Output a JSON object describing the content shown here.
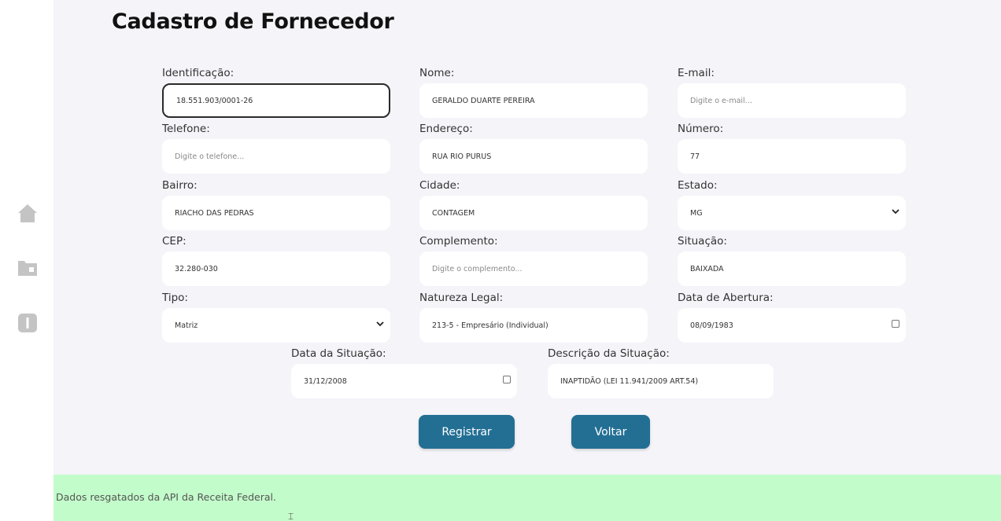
{
  "page": {
    "title": "Cadastro de Fornecedor"
  },
  "sidebar": {
    "icons": [
      "home-icon",
      "folder-icon",
      "info-icon"
    ]
  },
  "fields": {
    "identificacao": {
      "label": "Identificação:",
      "value": "18.551.903/0001-26"
    },
    "nome": {
      "label": "Nome:",
      "value": "GERALDO DUARTE PEREIRA"
    },
    "email": {
      "label": "E-mail:",
      "placeholder": "Digite o e-mail..."
    },
    "telefone": {
      "label": "Telefone:",
      "placeholder": "Digite o telefone..."
    },
    "endereco": {
      "label": "Endereço:",
      "value": "RUA RIO PURUS"
    },
    "numero": {
      "label": "Número:",
      "value": "77"
    },
    "bairro": {
      "label": "Bairro:",
      "value": "RIACHO DAS PEDRAS"
    },
    "cidade": {
      "label": "Cidade:",
      "value": "CONTAGEM"
    },
    "estado": {
      "label": "Estado:",
      "value": "MG"
    },
    "cep": {
      "label": "CEP:",
      "value": "32.280-030"
    },
    "complemento": {
      "label": "Complemento:",
      "placeholder": "Digite o complemento..."
    },
    "situacao": {
      "label": "Situação:",
      "value": "BAIXADA"
    },
    "tipo": {
      "label": "Tipo:",
      "value": "Matriz"
    },
    "natureza_legal": {
      "label": "Natureza Legal:",
      "value": "213-5 - Empresário (Individual)"
    },
    "data_abertura": {
      "label": "Data de Abertura:",
      "value": "08/09/1983"
    },
    "data_situacao": {
      "label": "Data da Situação:",
      "value": "31/12/2008"
    },
    "descricao_situacao": {
      "label": "Descrição da Situação:",
      "value": "INAPTIDÃO (LEI 11.941/2009 ART.54)"
    }
  },
  "buttons": {
    "registrar": "Registrar",
    "voltar": "Voltar"
  },
  "toast": {
    "message": "Dados resgatados da API da Receita Federal."
  },
  "colors": {
    "primary_button": "#236f94",
    "toast_bg": "#c3fccb",
    "background": "#f4f4f9"
  }
}
